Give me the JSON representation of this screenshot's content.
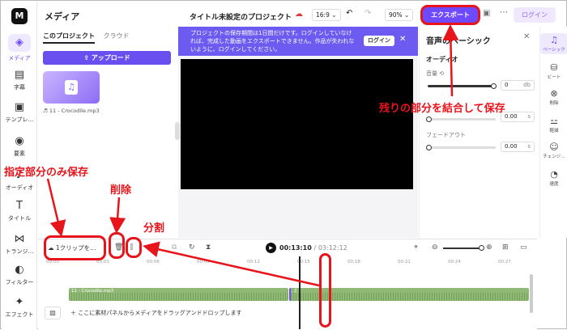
{
  "app": {
    "logo": "M"
  },
  "rail": [
    {
      "label": "メディア",
      "icon": "media-icon",
      "glyph": "◈"
    },
    {
      "label": "字幕",
      "icon": "subtitle-icon",
      "glyph": "▤"
    },
    {
      "label": "テンプレ…",
      "icon": "template-icon",
      "glyph": "▣"
    },
    {
      "label": "要素",
      "icon": "elements-icon",
      "glyph": "◉"
    },
    {
      "label": "オーディオ",
      "icon": "audio-icon",
      "glyph": "♪"
    },
    {
      "label": "タイトル",
      "icon": "title-icon",
      "glyph": "T"
    },
    {
      "label": "トランジ…",
      "icon": "transition-icon",
      "glyph": "⋈"
    },
    {
      "label": "フィルター",
      "icon": "filter-icon",
      "glyph": "◐"
    },
    {
      "label": "エフェクト",
      "icon": "effect-icon",
      "glyph": "✦"
    }
  ],
  "media": {
    "title": "メディア",
    "tabs": {
      "project": "このプロジェクト",
      "cloud": "クラウド"
    },
    "upload_label": "アップロード",
    "item_label": "11 - Crocodile.mp3"
  },
  "topbar": {
    "project_title": "タイトル未設定のプロジェクト",
    "ratio": "16:9 ⌄",
    "zoom": "90% ⌄",
    "export_label": "エクスポート",
    "login_label": "ログイン"
  },
  "notice": {
    "text": "プロジェクトの保存期間は1日間だけです。ログインしていなければ、完成した動画をエクスポートできません。作品が失われないように、ログインしてください。",
    "login_label": "ログイン"
  },
  "props": {
    "title": "音声のベーシック",
    "section_audio": "オーディオ",
    "volume_label": "音量",
    "volume_value": "0",
    "volume_unit": "db",
    "fadein_value": "0.00",
    "fadeout_label": "フェードアウト",
    "fadeout_value": "0.00",
    "time_unit": "s"
  },
  "right_rail": [
    {
      "label": "ベーシック",
      "icon": "basic-icon",
      "glyph": "♫"
    },
    {
      "label": "ビート",
      "icon": "beat-icon",
      "glyph": "⛁"
    },
    {
      "label": "削除",
      "icon": "remove-icon",
      "glyph": "⊗"
    },
    {
      "label": "軽減",
      "icon": "reduce-icon",
      "glyph": "⚍"
    },
    {
      "label": "チェンジ…",
      "icon": "change-icon",
      "glyph": "☺"
    },
    {
      "label": "速度",
      "icon": "speed-icon",
      "glyph": "◔"
    }
  ],
  "timeline": {
    "clip_save_label": "1クリップを…",
    "current_time": "00:13:10",
    "total_time": "/ 03:12:12",
    "ruler": [
      "00:00",
      "00:03",
      "00:06",
      "00:09",
      "00:12",
      "00:15",
      "00:18",
      "00:21",
      "00:24",
      "00:27"
    ],
    "clip1_name": "11 - Crocodile.mp3",
    "drop_text": "ここに素材パネルからメディアをドラッグアンドドロップします",
    "playhead_fraction": 0.52
  },
  "annotations": {
    "export": "残りの部分を結合して保存",
    "save_part": "指定部分のみ保存",
    "delete": "削除",
    "split": "分割",
    "color": "#e8141b"
  }
}
